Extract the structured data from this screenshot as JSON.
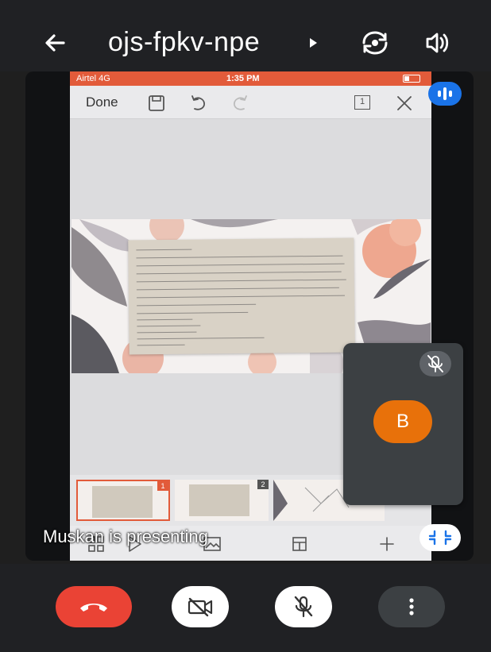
{
  "header": {
    "meeting_code": "ojs-fpkv-npe"
  },
  "shared_screen": {
    "status_bar": {
      "carrier": "Airtel  4G",
      "time": "1:35 PM"
    },
    "toolbar": {
      "done_label": "Done",
      "slide_count": "1"
    },
    "thumbnails": [
      {
        "number": "1",
        "active": true
      },
      {
        "number": "2",
        "active": false
      }
    ]
  },
  "participant_tile": {
    "initial": "B",
    "avatar_color": "#e8710a"
  },
  "presenting_text": "Muskan is presenting",
  "colors": {
    "hangup": "#ea4335",
    "accent": "#1a73e8",
    "slides_brand": "#e25b3a"
  },
  "icons": {
    "header": [
      "back-arrow-icon",
      "caret-right-icon",
      "switch-camera-icon",
      "speaker-icon"
    ],
    "controls": [
      "hang-up-icon",
      "video-off-icon",
      "mic-off-icon",
      "more-vert-icon"
    ]
  }
}
